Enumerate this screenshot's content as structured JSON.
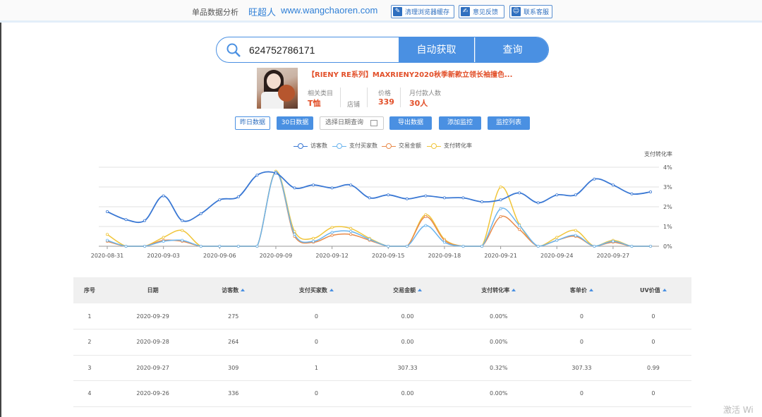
{
  "header": {
    "module": "单品数据分析",
    "brand": "旺超人",
    "site": "www.wangchaoren.com",
    "buttons": [
      {
        "label": "清理浏览器缓存",
        "icon": "broom-icon"
      },
      {
        "label": "意见反馈",
        "icon": "edit-icon"
      },
      {
        "label": "联系客服",
        "icon": "user-icon"
      }
    ]
  },
  "search": {
    "value": "624752786171",
    "auto_label": "自动获取",
    "query_label": "查询"
  },
  "product": {
    "title": "【RIENY RE系列】MAXRIENY2020秋季新款立领长袖撞色...",
    "category_label": "相关类目",
    "category_value": "T恤",
    "shop_label": "店铺",
    "price_label": "价格",
    "price_value": "339",
    "buyers_label": "月付款人数",
    "buyers_value": "30人"
  },
  "controls": {
    "yesterday": "昨日数据",
    "thirty": "30日数据",
    "date_placeholder": "选择日期查询",
    "export": "导出数据",
    "add_monitor": "添加监控",
    "monitor_list": "监控列表"
  },
  "chart_data": {
    "type": "line",
    "legend": [
      "访客数",
      "支付买家数",
      "交易金额",
      "支付转化率"
    ],
    "right_axis_label": "支付转化率",
    "right_ticks": [
      "4%",
      "3%",
      "2%",
      "1%",
      "0%"
    ],
    "x_ticks": [
      "2020-08-31",
      "2020-09-03",
      "2020-09-06",
      "2020-09-09",
      "2020-09-12",
      "2020-09-15",
      "2020-09-18",
      "2020-09-21",
      "2020-09-24",
      "2020-09-27"
    ],
    "ylim_rate": [
      0,
      4
    ],
    "colors": [
      "#3a78d4",
      "#6ab4ee",
      "#e88a4a",
      "#f0c53a"
    ],
    "series": [
      {
        "name": "访客数",
        "values": [
          1.75,
          1.35,
          1.3,
          2.55,
          1.3,
          1.65,
          2.35,
          2.5,
          3.6,
          3.7,
          2.95,
          3.1,
          2.95,
          3.1,
          2.45,
          2.6,
          2.4,
          2.55,
          2.45,
          2.45,
          2.25,
          2.35,
          2.7,
          2.2,
          2.6,
          2.6,
          3.4,
          3.1,
          2.65,
          2.75
        ]
      },
      {
        "name": "支付买家数",
        "values": [
          0.3,
          0,
          0,
          0.25,
          0.3,
          0,
          0,
          0,
          0,
          3.75,
          0.6,
          0.25,
          0.7,
          0.75,
          0.35,
          0,
          0,
          1.05,
          0.2,
          0,
          0,
          1.9,
          1.05,
          0,
          0.3,
          0.55,
          0,
          0.25,
          0,
          0
        ]
      },
      {
        "name": "交易金额",
        "values": [
          0.25,
          0,
          0,
          0.3,
          0.25,
          0,
          0,
          0,
          0,
          3.75,
          0.5,
          0.2,
          0.55,
          0.6,
          0.3,
          0,
          0,
          1.5,
          0.3,
          0,
          0,
          1.5,
          0.85,
          0,
          0.3,
          0.5,
          0,
          0.2,
          0,
          0
        ]
      },
      {
        "name": "支付转化率",
        "values": [
          0.6,
          0,
          0,
          0.45,
          0.8,
          0,
          0,
          0,
          0,
          3.8,
          0.75,
          0.4,
          0.95,
          0.9,
          0.4,
          0,
          0,
          1.6,
          0.35,
          0,
          0,
          3.0,
          1.1,
          0,
          0.45,
          0.8,
          0,
          0.3,
          0,
          0
        ]
      }
    ]
  },
  "table": {
    "headers": [
      "序号",
      "日期",
      "访客数",
      "支付买家数",
      "交易金额",
      "支付转化率",
      "客单价",
      "UV价值"
    ],
    "rows": [
      [
        "1",
        "2020-09-29",
        "275",
        "0",
        "0.00",
        "0.00%",
        "0",
        "0"
      ],
      [
        "2",
        "2020-09-28",
        "264",
        "0",
        "0.00",
        "0.00%",
        "0",
        "0"
      ],
      [
        "3",
        "2020-09-27",
        "309",
        "1",
        "307.33",
        "0.32%",
        "307.33",
        "0.99"
      ],
      [
        "4",
        "2020-09-26",
        "336",
        "0",
        "0.00",
        "0.00%",
        "0",
        "0"
      ]
    ]
  },
  "watermark": "激活 Wi"
}
